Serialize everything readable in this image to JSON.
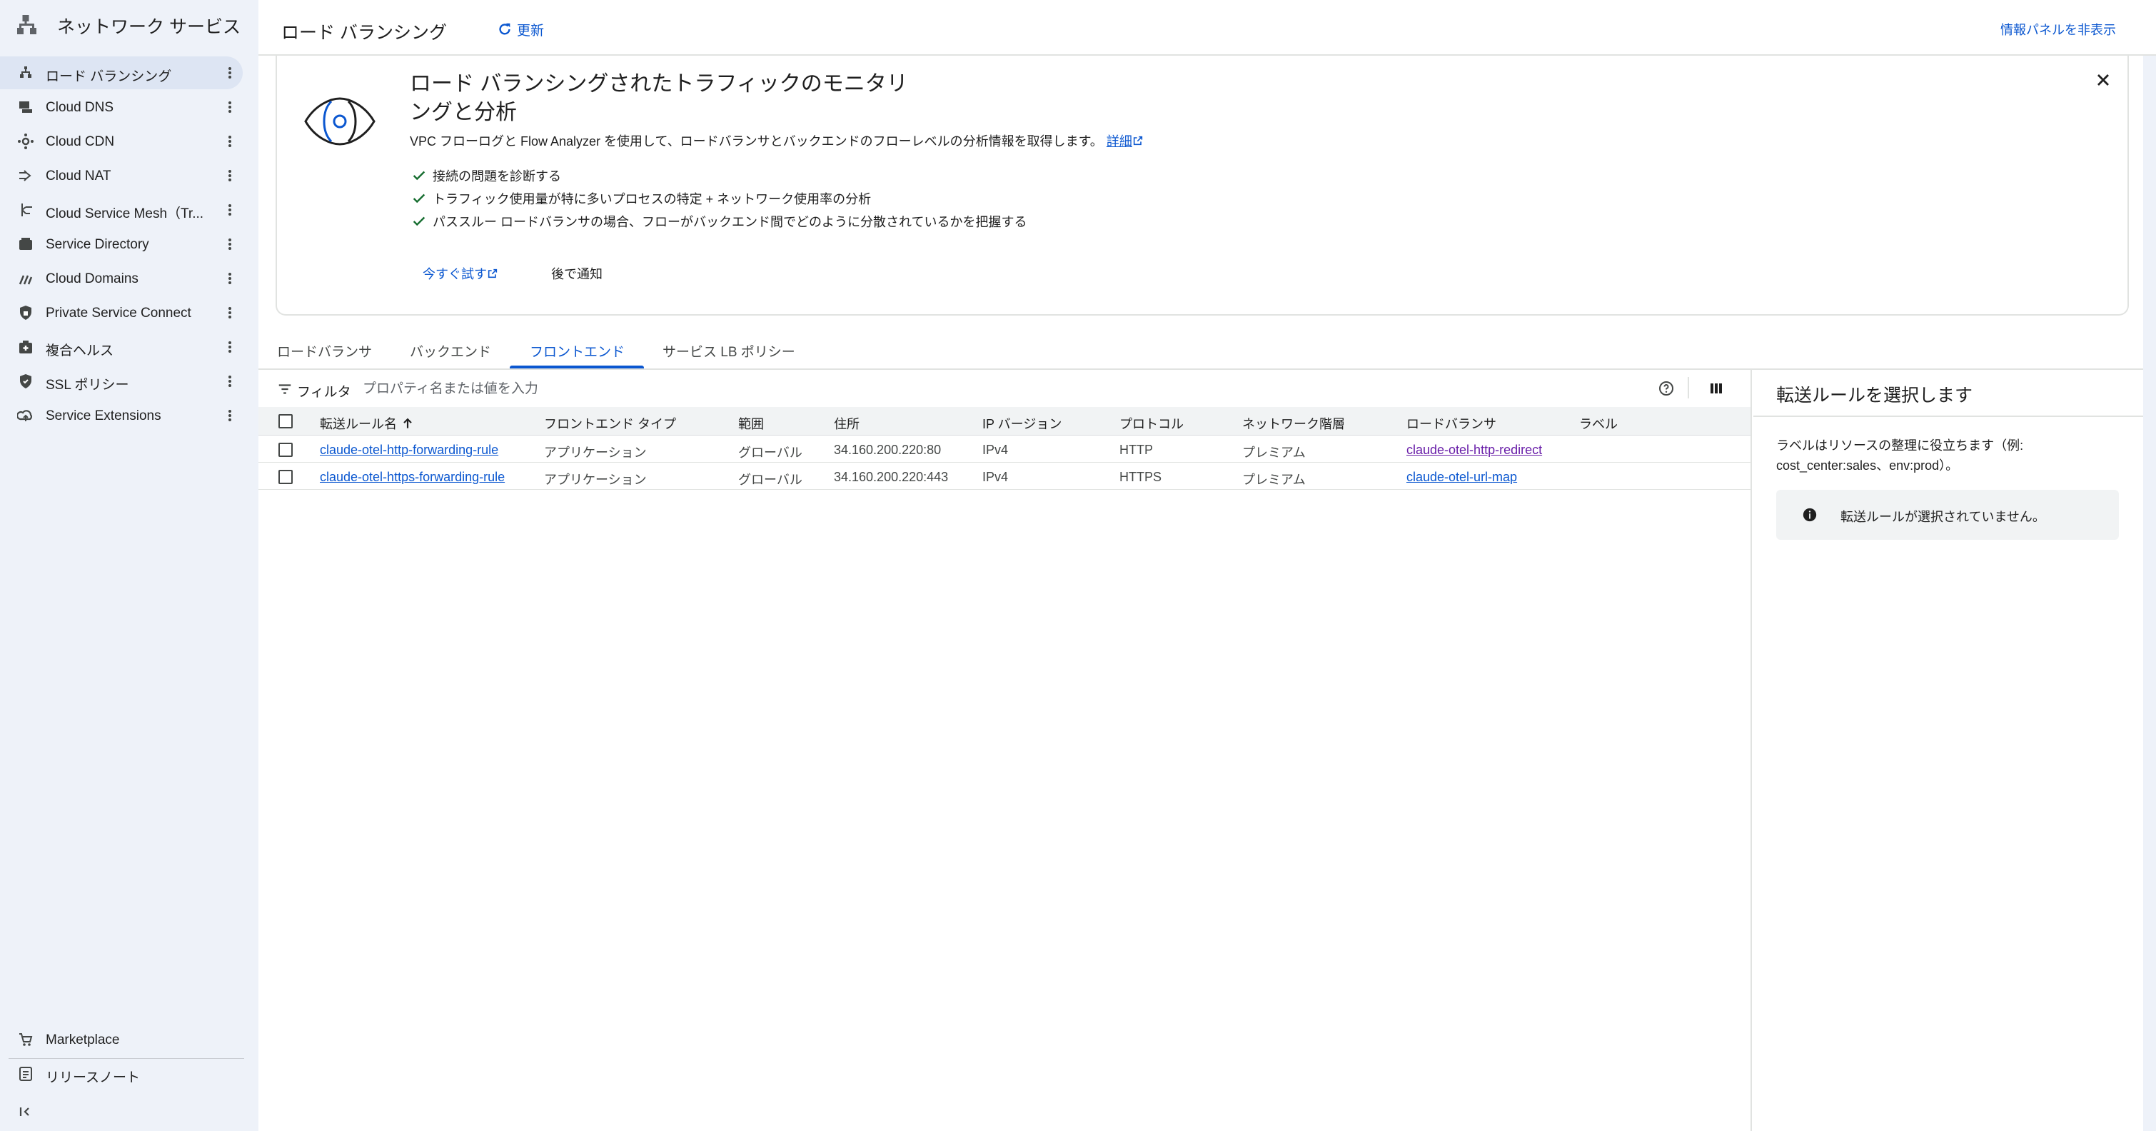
{
  "sidebar": {
    "title": "ネットワーク サービス",
    "items": [
      {
        "label": "ロード バランシング",
        "icon": "load-balancing-icon",
        "active": true
      },
      {
        "label": "Cloud DNS",
        "icon": "dns-icon"
      },
      {
        "label": "Cloud CDN",
        "icon": "cdn-icon"
      },
      {
        "label": "Cloud NAT",
        "icon": "nat-icon"
      },
      {
        "label": "Cloud Service Mesh（Tr...",
        "icon": "service-mesh-icon"
      },
      {
        "label": "Service Directory",
        "icon": "service-directory-icon"
      },
      {
        "label": "Cloud Domains",
        "icon": "domains-icon"
      },
      {
        "label": "Private Service Connect",
        "icon": "private-service-connect-icon"
      },
      {
        "label": "複合ヘルス",
        "icon": "composite-health-icon"
      },
      {
        "label": "SSL ポリシー",
        "icon": "ssl-policy-icon"
      },
      {
        "label": "Service Extensions",
        "icon": "service-extensions-icon"
      }
    ],
    "bottom": [
      {
        "label": "Marketplace",
        "icon": "marketplace-icon"
      },
      {
        "label": "リリースノート",
        "icon": "release-notes-icon"
      }
    ]
  },
  "header": {
    "title": "ロード バランシング",
    "refresh_label": "更新",
    "hide_panel_label": "情報パネルを非表示"
  },
  "promo": {
    "title": "ロード バランシングされたトラフィックのモニタリングと分析",
    "description": "VPC フローログと Flow Analyzer を使用して、ロードバランサとバックエンドのフローレベルの分析情報を取得します。",
    "details_link": "詳細",
    "checks": [
      "接続の問題を診断する",
      "トラフィック使用量が特に多いプロセスの特定 + ネットワーク使用率の分析",
      "パススルー ロードバランサの場合、フローがバックエンド間でどのように分散されているかを把握する"
    ],
    "try_label": "今すぐ試す",
    "later_label": "後で通知"
  },
  "tabs": [
    {
      "label": "ロードバランサ"
    },
    {
      "label": "バックエンド"
    },
    {
      "label": "フロントエンド",
      "active": true
    },
    {
      "label": "サービス LB ポリシー"
    }
  ],
  "filter": {
    "label": "フィルタ",
    "placeholder": "プロパティ名または値を入力"
  },
  "table": {
    "columns": [
      "転送ルール名",
      "フロントエンド タイプ",
      "範囲",
      "住所",
      "IP バージョン",
      "プロトコル",
      "ネットワーク階層",
      "ロードバランサ",
      "ラベル"
    ],
    "rows": [
      {
        "name": "claude-otel-http-forwarding-rule",
        "type": "アプリケーション",
        "scope": "グローバル",
        "address": "34.160.200.220:80",
        "ip": "IPv4",
        "protocol": "HTTP",
        "tier": "プレミアム",
        "lb": "claude-otel-http-redirect",
        "labels": ""
      },
      {
        "name": "claude-otel-https-forwarding-rule",
        "type": "アプリケーション",
        "scope": "グローバル",
        "address": "34.160.200.220:443",
        "ip": "IPv4",
        "protocol": "HTTPS",
        "tier": "プレミアム",
        "lb": "claude-otel-url-map",
        "labels": ""
      }
    ]
  },
  "info_panel": {
    "title": "転送ルールを選択します",
    "description": "ラベルはリソースの整理に役立ちます（例: cost_center:sales、env:prod）。",
    "empty_message": "転送ルールが選択されていません。"
  },
  "colors": {
    "accent": "#0b57d0",
    "active_bg": "#dde5f3",
    "visited_link": "#681da8",
    "check": "#146c2e"
  }
}
